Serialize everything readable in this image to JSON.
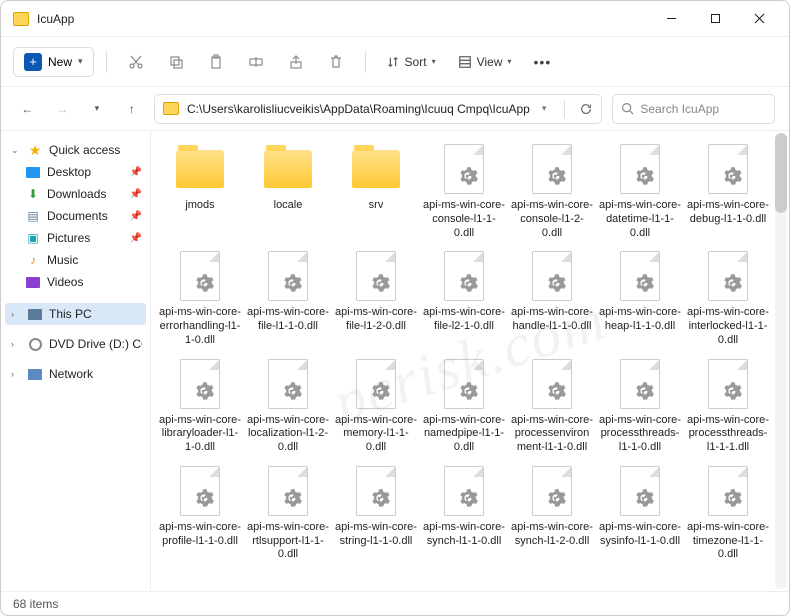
{
  "title": "IcuApp",
  "toolbar": {
    "new": "New",
    "sort": "Sort",
    "view": "View"
  },
  "address": {
    "path": "C:\\Users\\karolisliucveikis\\AppData\\Roaming\\Icuuq Cmpq\\IcuApp"
  },
  "search": {
    "placeholder": "Search IcuApp"
  },
  "sidebar": {
    "quick": "Quick access",
    "items": [
      {
        "label": "Desktop"
      },
      {
        "label": "Downloads"
      },
      {
        "label": "Documents"
      },
      {
        "label": "Pictures"
      },
      {
        "label": "Music"
      },
      {
        "label": "Videos"
      }
    ],
    "thispc": "This PC",
    "dvd": "DVD Drive (D:) CCCC",
    "network": "Network"
  },
  "items": [
    {
      "type": "folder",
      "label": "jmods"
    },
    {
      "type": "folder",
      "label": "locale"
    },
    {
      "type": "folder",
      "label": "srv"
    },
    {
      "type": "dll",
      "label": "api-ms-win-core-console-l1-1-0.dll"
    },
    {
      "type": "dll",
      "label": "api-ms-win-core-console-l1-2-0.dll"
    },
    {
      "type": "dll",
      "label": "api-ms-win-core-datetime-l1-1-0.dll"
    },
    {
      "type": "dll",
      "label": "api-ms-win-core-debug-l1-1-0.dll"
    },
    {
      "type": "dll",
      "label": "api-ms-win-core-errorhandling-l1-1-0.dll"
    },
    {
      "type": "dll",
      "label": "api-ms-win-core-file-l1-1-0.dll"
    },
    {
      "type": "dll",
      "label": "api-ms-win-core-file-l1-2-0.dll"
    },
    {
      "type": "dll",
      "label": "api-ms-win-core-file-l2-1-0.dll"
    },
    {
      "type": "dll",
      "label": "api-ms-win-core-handle-l1-1-0.dll"
    },
    {
      "type": "dll",
      "label": "api-ms-win-core-heap-l1-1-0.dll"
    },
    {
      "type": "dll",
      "label": "api-ms-win-core-interlocked-l1-1-0.dll"
    },
    {
      "type": "dll",
      "label": "api-ms-win-core-libraryloader-l1-1-0.dll"
    },
    {
      "type": "dll",
      "label": "api-ms-win-core-localization-l1-2-0.dll"
    },
    {
      "type": "dll",
      "label": "api-ms-win-core-memory-l1-1-0.dll"
    },
    {
      "type": "dll",
      "label": "api-ms-win-core-namedpipe-l1-1-0.dll"
    },
    {
      "type": "dll",
      "label": "api-ms-win-core-processenvironment-l1-1-0.dll"
    },
    {
      "type": "dll",
      "label": "api-ms-win-core-processthreads-l1-1-0.dll"
    },
    {
      "type": "dll",
      "label": "api-ms-win-core-processthreads-l1-1-1.dll"
    },
    {
      "type": "dll",
      "label": "api-ms-win-core-profile-l1-1-0.dll"
    },
    {
      "type": "dll",
      "label": "api-ms-win-core-rtlsupport-l1-1-0.dll"
    },
    {
      "type": "dll",
      "label": "api-ms-win-core-string-l1-1-0.dll"
    },
    {
      "type": "dll",
      "label": "api-ms-win-core-synch-l1-1-0.dll"
    },
    {
      "type": "dll",
      "label": "api-ms-win-core-synch-l1-2-0.dll"
    },
    {
      "type": "dll",
      "label": "api-ms-win-core-sysinfo-l1-1-0.dll"
    },
    {
      "type": "dll",
      "label": "api-ms-win-core-timezone-l1-1-0.dll"
    }
  ],
  "status": "68 items",
  "watermark": "pcrisk.com"
}
